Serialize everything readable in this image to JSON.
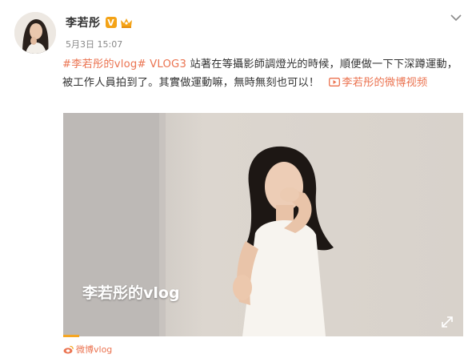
{
  "header": {
    "username": "李若彤",
    "verified_badge": "V",
    "timestamp": "5月3日 15:07"
  },
  "post": {
    "hashtag1": "#李若彤的vlog#",
    "hashtag2": "VLOG3",
    "body": " 站著在等攝影師調燈光的時候，順便做一下下深蹲運動，被工作人員拍到了。其實做運動嘛，無時無刻也可以！",
    "video_link": "李若彤的微博视频"
  },
  "video": {
    "caption": "李若彤的vlog",
    "progress": 0.04
  },
  "footer": {
    "source": "微博vlog"
  },
  "colors": {
    "link": "#eb7350",
    "badge": "#f4a316",
    "progress": "#f5a623"
  },
  "icons": [
    "avatar-image",
    "verified-v-icon",
    "rank-crown-icon",
    "chevron-down-icon",
    "video-play-icon",
    "fullscreen-expand-icon",
    "weibo-logo-icon"
  ]
}
